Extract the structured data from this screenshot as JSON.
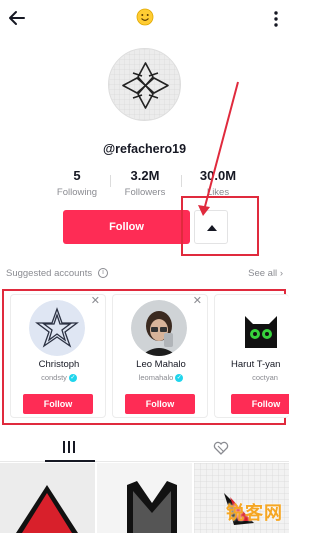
{
  "header": {
    "back_icon": "arrow-left-icon",
    "emoji_icon": "smiley-emoji-icon",
    "more_icon": "more-vertical-icon"
  },
  "profile": {
    "username": "@refachero19",
    "stats": [
      {
        "value": "5",
        "label": "Following"
      },
      {
        "value": "3.2M",
        "label": "Followers"
      },
      {
        "value": "30.0M",
        "label": "Likes"
      }
    ]
  },
  "actions": {
    "follow_label": "Follow",
    "dropdown_icon": "triangle-up-icon"
  },
  "suggested": {
    "title": "Suggested accounts",
    "see_all": "See all",
    "accounts": [
      {
        "name": "Christoph",
        "handle": "condsty",
        "verified": true,
        "follow_label": "Follow"
      },
      {
        "name": "Leo Mahalo",
        "handle": "leomahalo",
        "verified": true,
        "follow_label": "Follow"
      },
      {
        "name": "Harut T-yan",
        "handle": "coctyan",
        "verified": false,
        "follow_label": "Follow"
      }
    ]
  },
  "tabs": [
    {
      "icon": "grid-videos-icon",
      "active": true
    },
    {
      "icon": "liked-videos-icon",
      "active": false
    }
  ],
  "watermark": "锐客网",
  "colors": {
    "accent": "#fe2c55",
    "annotation": "#e02a3d",
    "verified": "#20d5ec"
  }
}
